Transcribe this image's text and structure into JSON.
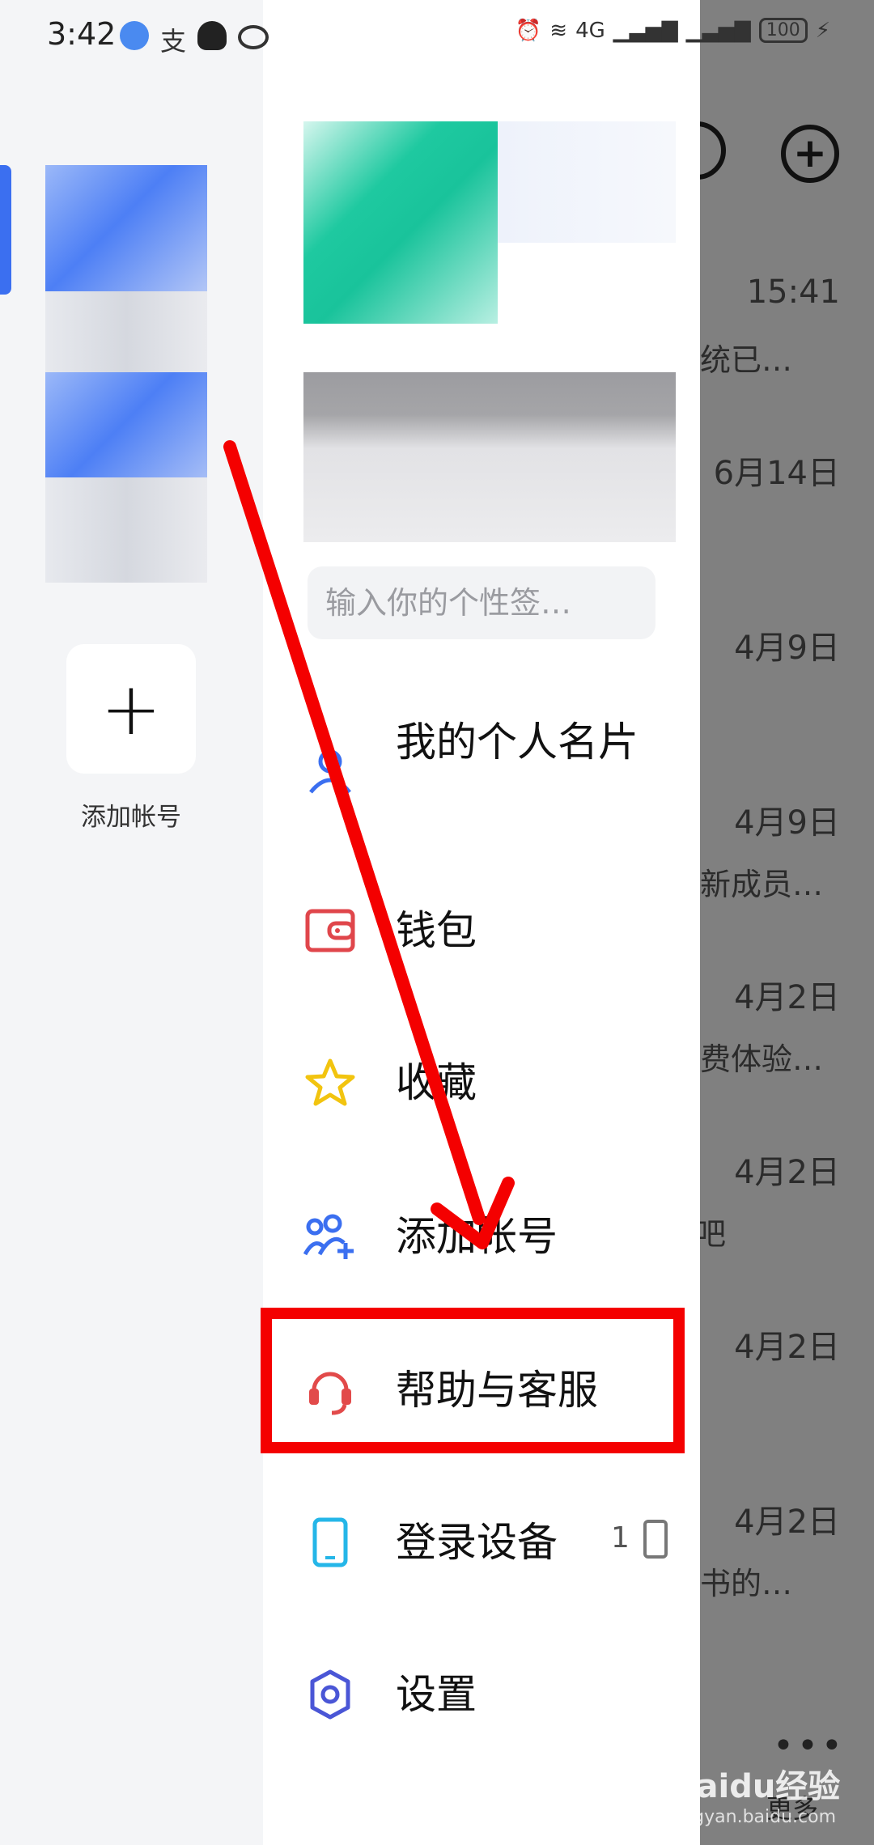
{
  "status_bar": {
    "time": "3:42",
    "battery": "100",
    "network": "4G"
  },
  "accounts": {
    "add_account_label": "添加帐号",
    "add_icon": "+"
  },
  "profile": {
    "signature_placeholder": "输入你的个性签…"
  },
  "menu": {
    "items": [
      {
        "label": "我的个人名片",
        "icon": "person-card-icon"
      },
      {
        "label": "钱包",
        "icon": "wallet-icon"
      },
      {
        "label": "收藏",
        "icon": "star-icon"
      },
      {
        "label": "添加帐号",
        "icon": "add-account-icon"
      },
      {
        "label": "帮助与客服",
        "icon": "headset-icon"
      },
      {
        "label": "登录设备",
        "icon": "phone-device-icon",
        "count": "1"
      },
      {
        "label": "设置",
        "icon": "gear-icon"
      }
    ]
  },
  "chat_list": {
    "entries": [
      {
        "date": "15:41",
        "snippet": "统已…"
      },
      {
        "date": "6月14日",
        "snippet": ""
      },
      {
        "date": "4月9日",
        "snippet": ""
      },
      {
        "date": "4月9日",
        "snippet": "新成员…"
      },
      {
        "date": "4月2日",
        "snippet": "费体验…"
      },
      {
        "date": "4月2日",
        "snippet": "吧"
      },
      {
        "date": "4月2日",
        "snippet": ""
      },
      {
        "date": "4月2日",
        "snippet": "书的…"
      }
    ],
    "more_label": "更多"
  },
  "annotation": {
    "highlighted_item": "帮助与客服",
    "arrow_color": "#f40000"
  },
  "watermark": {
    "brand": "Baidu经验",
    "url": "jingyan.baidu.com"
  },
  "colors": {
    "accent_blue": "#3b6ff0",
    "wallet_red": "#e0464b",
    "star_yellow": "#f2c40f",
    "headset_red": "#e24a4a",
    "device_cyan": "#25b6e8",
    "settings_indigo": "#4a56d6"
  }
}
